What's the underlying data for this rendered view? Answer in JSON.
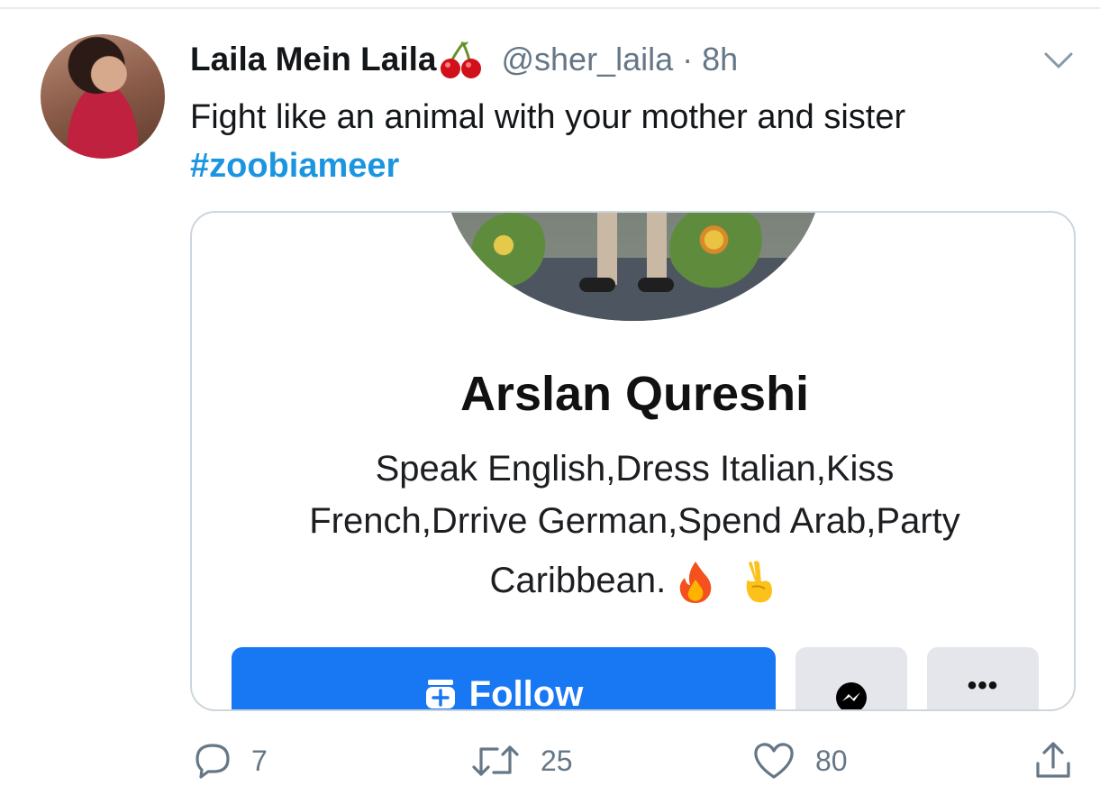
{
  "tweet": {
    "author": {
      "display_name": "Laila Mein Laila",
      "handle": "@sher_laila",
      "separator": "·",
      "time": "8h"
    },
    "text": "Fight like an animal with your mother and sister",
    "hashtag": "#zoobiameer"
  },
  "card": {
    "profile_name": "Arslan Qureshi",
    "bio_line_1": "Speak English,Dress Italian,Kiss",
    "bio_line_2": "French,Drrive German,Spend Arab,Party",
    "bio_line_3": "Caribbean.",
    "follow_label": "Follow",
    "more_label": "•••"
  },
  "actions": {
    "replies": "7",
    "retweets": "25",
    "likes": "80"
  },
  "colors": {
    "link": "#1b95e0",
    "secondary_text": "#657786",
    "facebook_blue": "#1877f2",
    "card_border": "#ccd6dd"
  },
  "icons": [
    "cherry-icon",
    "chevron-down-icon",
    "fire-icon",
    "victory-hand-icon",
    "follow-add-icon",
    "messenger-icon",
    "reply-icon",
    "retweet-icon",
    "like-icon",
    "share-icon"
  ]
}
